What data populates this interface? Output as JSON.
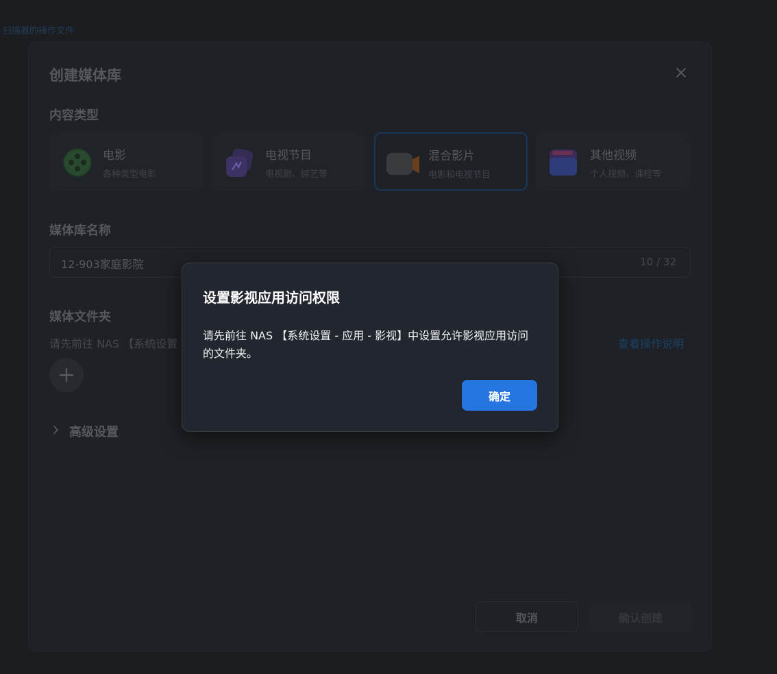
{
  "top_link": "扫描器的操作文件",
  "panel": {
    "title": "创建媒体库",
    "content_type_label": "内容类型",
    "types": [
      {
        "name": "电影",
        "desc": "各种类型电影",
        "icon": "film-reel-icon"
      },
      {
        "name": "电视节目",
        "desc": "电视剧、综艺等",
        "icon": "tv-icon"
      },
      {
        "name": "混合影片",
        "desc": "电影和电视节目",
        "icon": "video-camera-icon",
        "selected": true
      },
      {
        "name": "其他视频",
        "desc": "个人视频、课程等",
        "icon": "video-folder-icon"
      }
    ],
    "library_name_label": "媒体库名称",
    "library_name_value": "12-903家庭影院",
    "library_name_counter": "10 / 32",
    "folder_label": "媒体文件夹",
    "folder_hint": "请先前往 NAS 【系统设置",
    "folder_help_link": "查看操作说明",
    "advanced_label": "高级设置",
    "cancel_label": "取消",
    "confirm_label": "确认创建"
  },
  "dialog": {
    "title": "设置影视应用访问权限",
    "message": "请先前往 NAS 【系统设置 - 应用 - 影视】中设置允许影视应用访问的文件夹。",
    "ok_label": "确定",
    "accent_color": "#2575e0"
  }
}
